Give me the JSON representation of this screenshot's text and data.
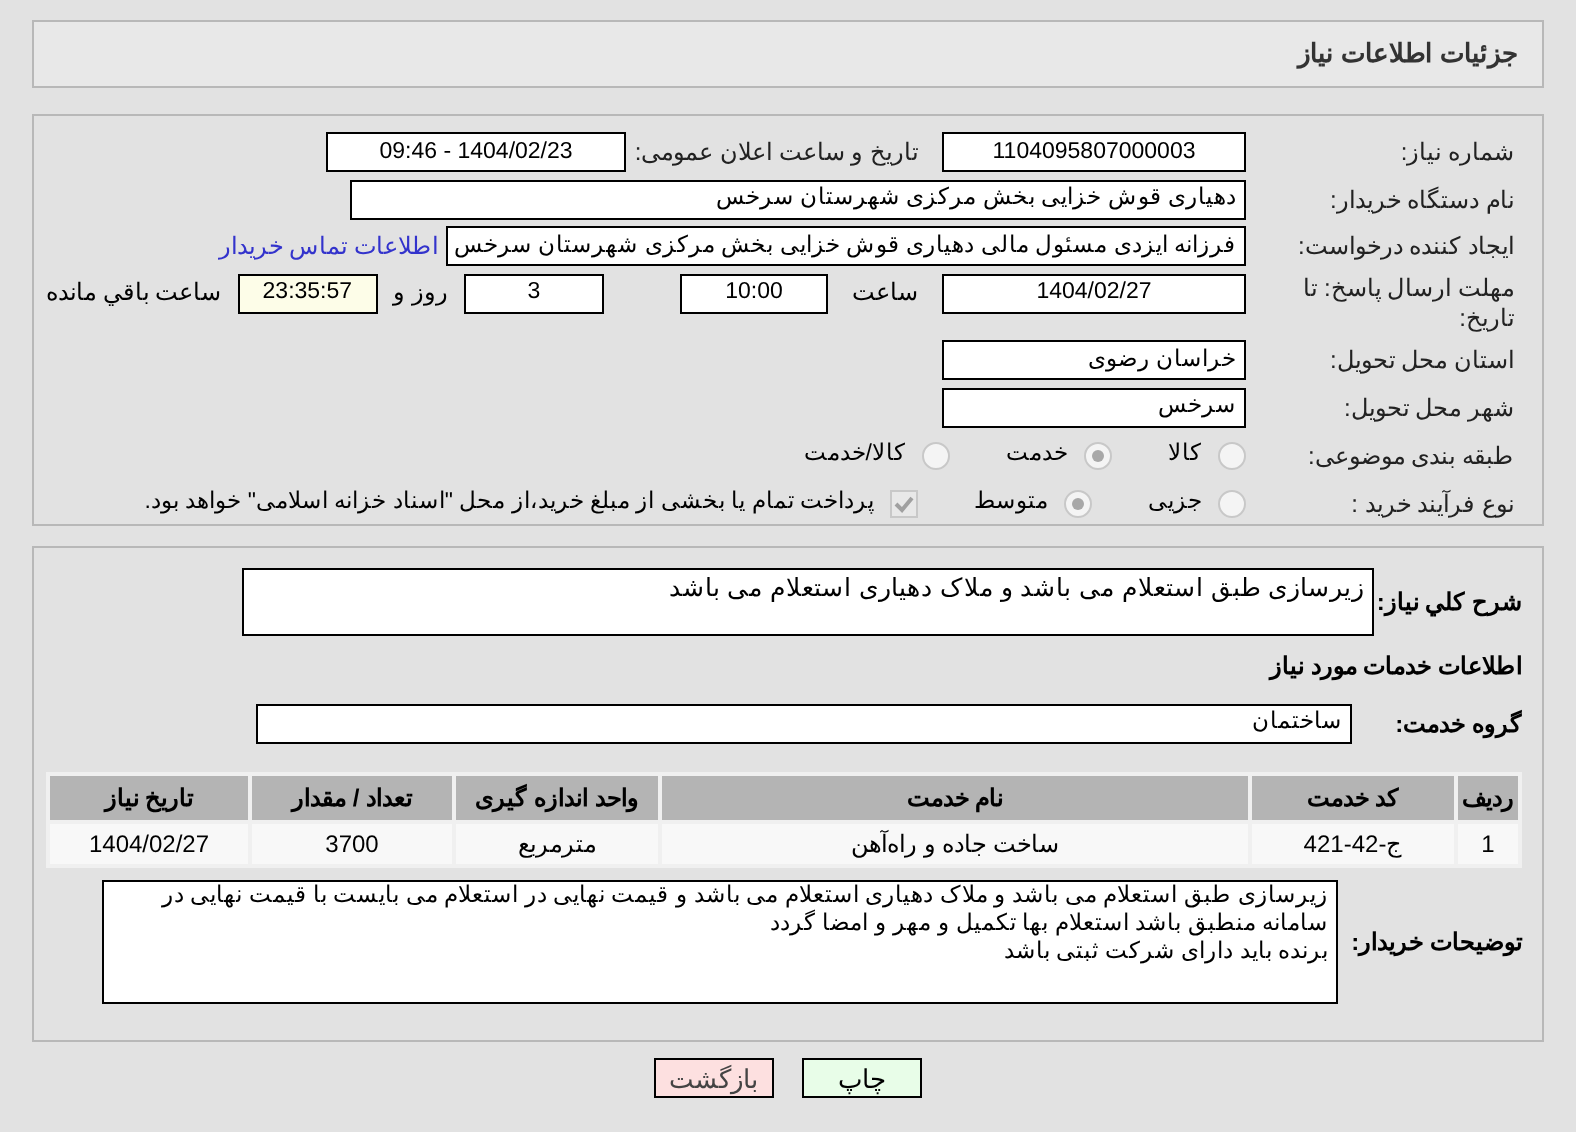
{
  "header": {
    "title": "جزئیات اطلاعات نیاز"
  },
  "form": {
    "need_number": {
      "label": "شماره نیاز:",
      "value": "1104095807000003"
    },
    "announce": {
      "label": "تاریخ و ساعت اعلان عمومی:",
      "value": "1404/02/23 - 09:46"
    },
    "buyer": {
      "label": "نام دستگاه خریدار:",
      "value": "دهیاری قوش خزایی بخش مرکزی شهرستان سرخس"
    },
    "creator": {
      "label": "ایجاد کننده درخواست:",
      "value": "فرزانه ایزدی مسئول مالی دهیاری قوش خزایی بخش مرکزی شهرستان سرخس",
      "link": "اطلاعات تماس خریدار"
    },
    "deadline": {
      "label": "مهلت ارسال پاسخ: تا تاریخ:",
      "date": "1404/02/27",
      "time_label": "ساعت",
      "time": "10:00",
      "days": "3",
      "days_label": "روز و",
      "remaining": "23:35:57",
      "remaining_label": "ساعت باقي مانده"
    },
    "province": {
      "label": "استان محل تحویل:",
      "value": "خراسان رضوی"
    },
    "city": {
      "label": "شهر محل تحویل:",
      "value": "سرخس"
    },
    "category": {
      "label": "طبقه بندی موضوعی:",
      "options": [
        {
          "label": "کالا",
          "selected": false
        },
        {
          "label": "خدمت",
          "selected": true
        },
        {
          "label": "کالا/خدمت",
          "selected": false
        }
      ]
    },
    "process": {
      "label": "نوع فرآیند خرید :",
      "options": [
        {
          "label": "جزیی",
          "selected": false
        },
        {
          "label": "متوسط",
          "selected": true
        }
      ],
      "treasury": {
        "label": "پرداخت تمام یا بخشی از مبلغ خرید،از محل \"اسناد خزانه اسلامی\" خواهد بود.",
        "checked": true
      }
    }
  },
  "details": {
    "summary": {
      "label": "شرح کلي نیاز:",
      "value": "زیرسازی طبق استعلام می باشد و ملاک دهیاری استعلام می باشد"
    },
    "section_title": "اطلاعات خدمات مورد نیاز",
    "service_group": {
      "label": "گروه خدمت:",
      "value": "ساختمان"
    },
    "table": {
      "columns": [
        "ردیف",
        "کد خدمت",
        "نام خدمت",
        "واحد اندازه گیری",
        "تعداد / مقدار",
        "تاریخ نیاز"
      ],
      "rows": [
        [
          "1",
          "ج-42-421",
          "ساخت جاده و راه‌آهن",
          "مترمربع",
          "3700",
          "1404/02/27"
        ]
      ]
    },
    "notes": {
      "label": "توضیحات خریدار:",
      "lines": [
        "زیرسازی طبق استعلام می باشد و ملاک دهیاری استعلام می باشد و قیمت نهایی در استعلام می بایست با قیمت نهایی در سامانه منطبق باشد استعلام بها تکمیل و مهر و امضا گردد",
        "برنده باید دارای شرکت ثبتی باشد"
      ]
    }
  },
  "buttons": [
    {
      "label": "چاپ",
      "kind": "print"
    },
    {
      "label": "بازگشت",
      "kind": "back"
    }
  ]
}
